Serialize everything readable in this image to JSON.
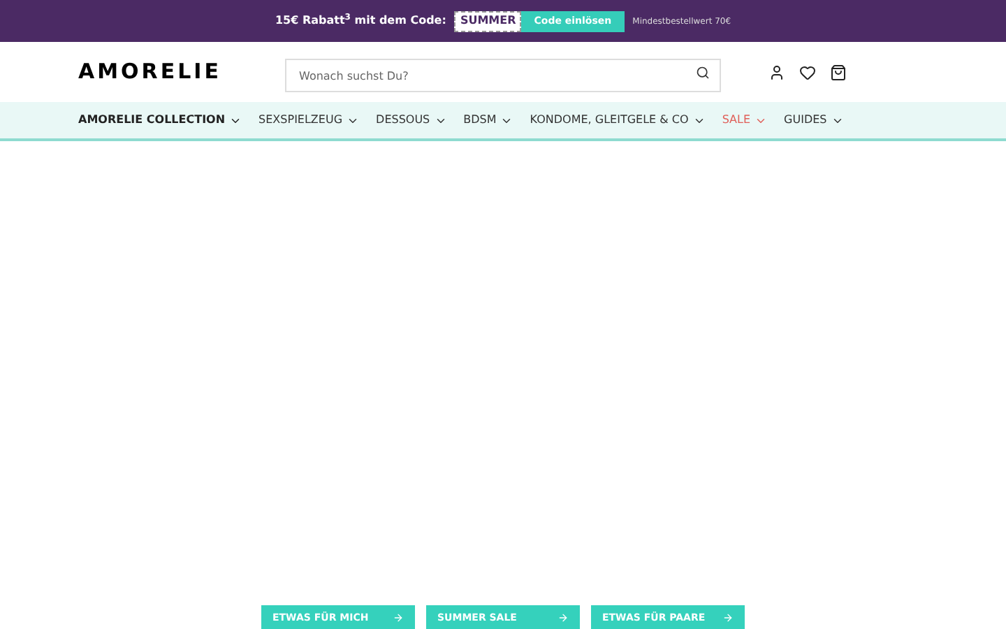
{
  "promo_bar": {
    "text": "15€ Rabatt$^{3}$ mit dem Code:",
    "code": "SUMMER",
    "button": "Code einlösen",
    "note": "Mindestbestellwert 70€"
  },
  "header": {
    "logo": "AMORELIE",
    "search": {
      "placeholder": "Wonach suchst Du?"
    }
  },
  "nav": [
    {
      "label": "AMORELIE COLLECTION",
      "kind": "bold"
    },
    {
      "label": "SEXSPIELZEUG",
      "kind": "normal"
    },
    {
      "label": "DESSOUS",
      "kind": "normal"
    },
    {
      "label": "BDSM",
      "kind": "normal"
    },
    {
      "label": "KONDOME, GLEITGELE & CO",
      "kind": "normal"
    },
    {
      "label": "SALE",
      "kind": "sale"
    },
    {
      "label": "GUIDES",
      "kind": "normal"
    }
  ],
  "hero_buttons": [
    "ETWAS FÜR MICH",
    "SUMMER SALE",
    "ETWAS FÜR PAARE"
  ]
}
